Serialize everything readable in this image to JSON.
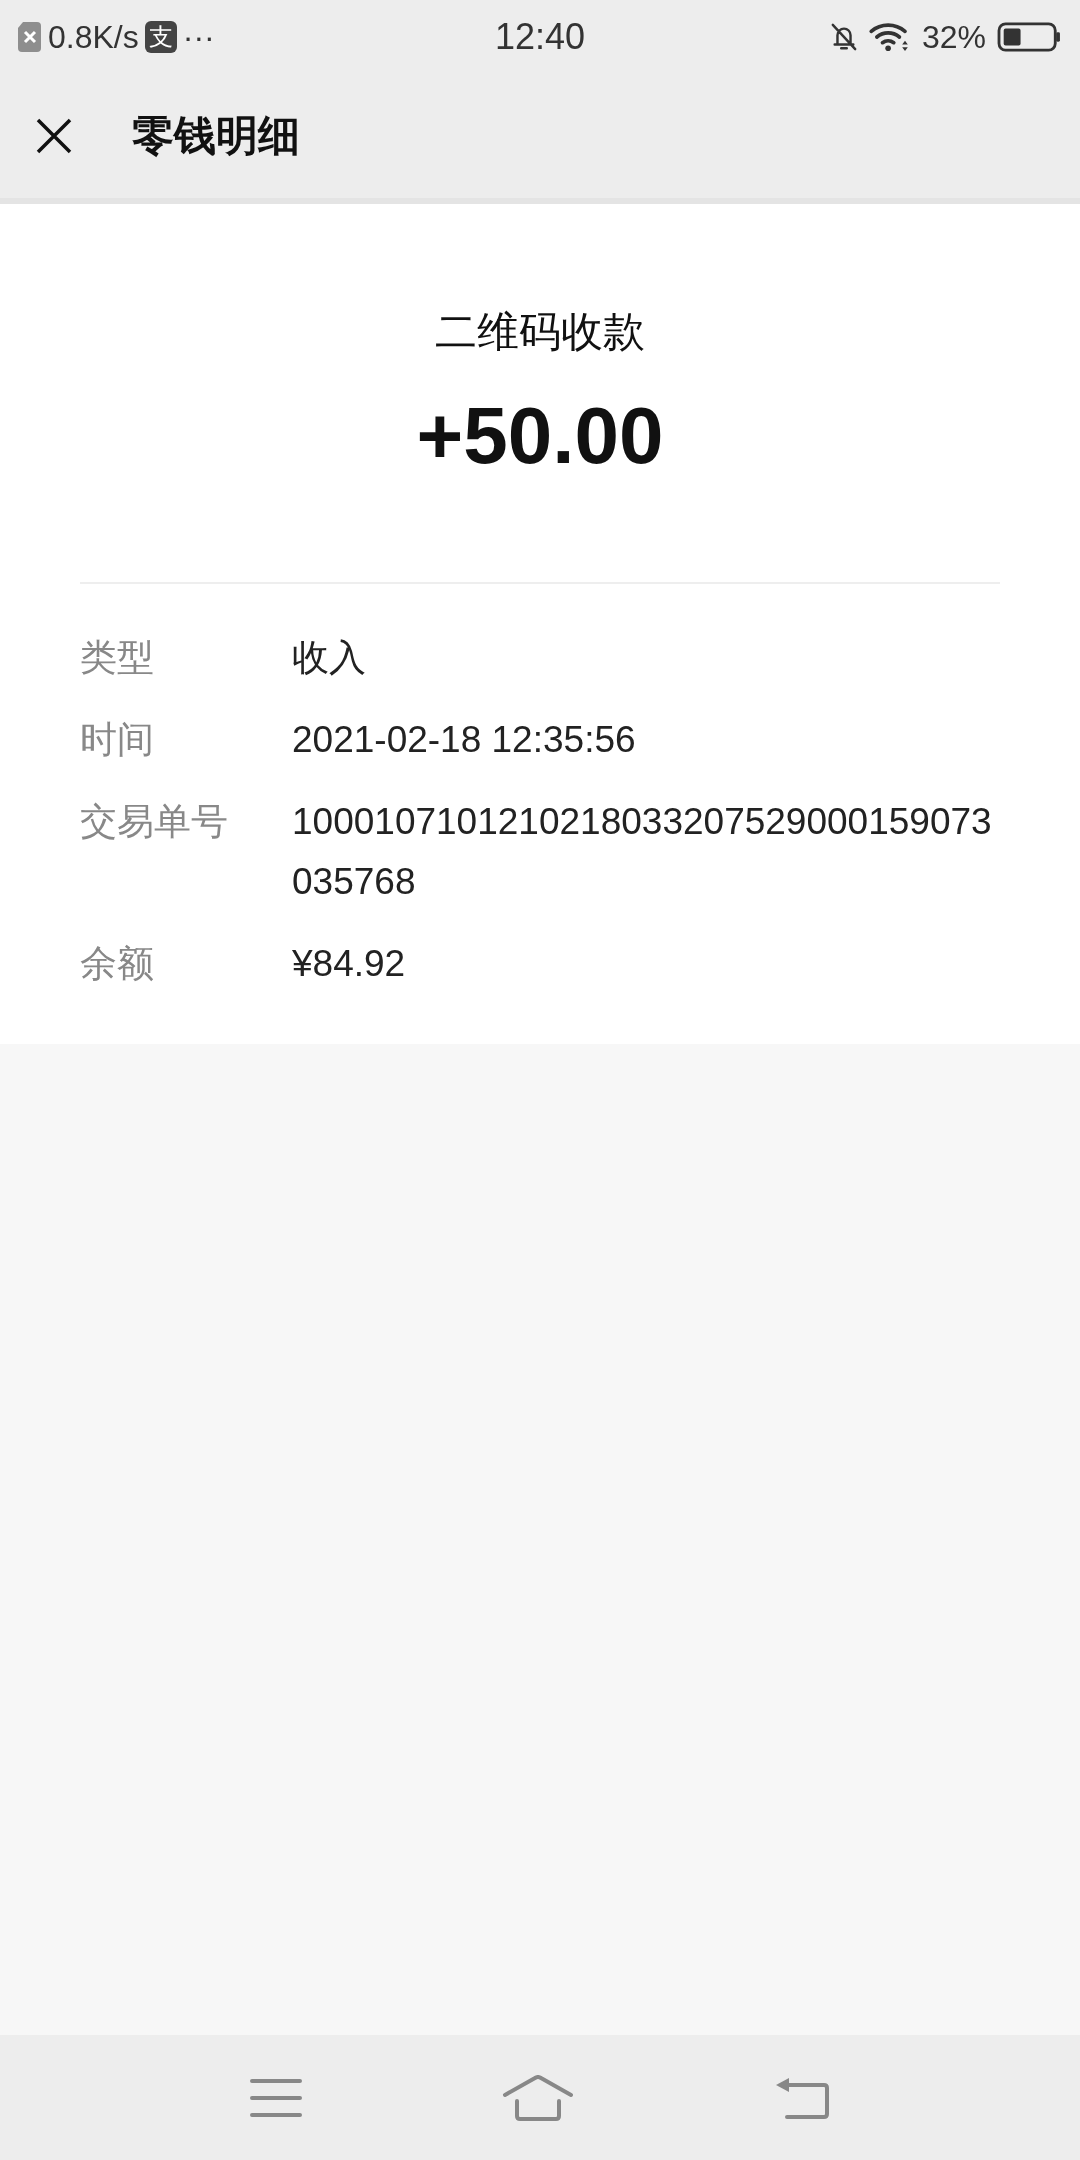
{
  "status_bar": {
    "speed": "0.8K/s",
    "app_badge": "支",
    "more": "···",
    "time": "12:40",
    "battery": "32%"
  },
  "header": {
    "title": "零钱明细"
  },
  "summary": {
    "title": "二维码收款",
    "amount": "+50.00"
  },
  "details": [
    {
      "label": "类型",
      "value": "收入"
    },
    {
      "label": "时间",
      "value": "2021-02-18 12:35:56"
    },
    {
      "label": "交易单号",
      "value": "1000107101210218033207529000159073035768"
    },
    {
      "label": "余额",
      "value": "¥84.92"
    }
  ]
}
